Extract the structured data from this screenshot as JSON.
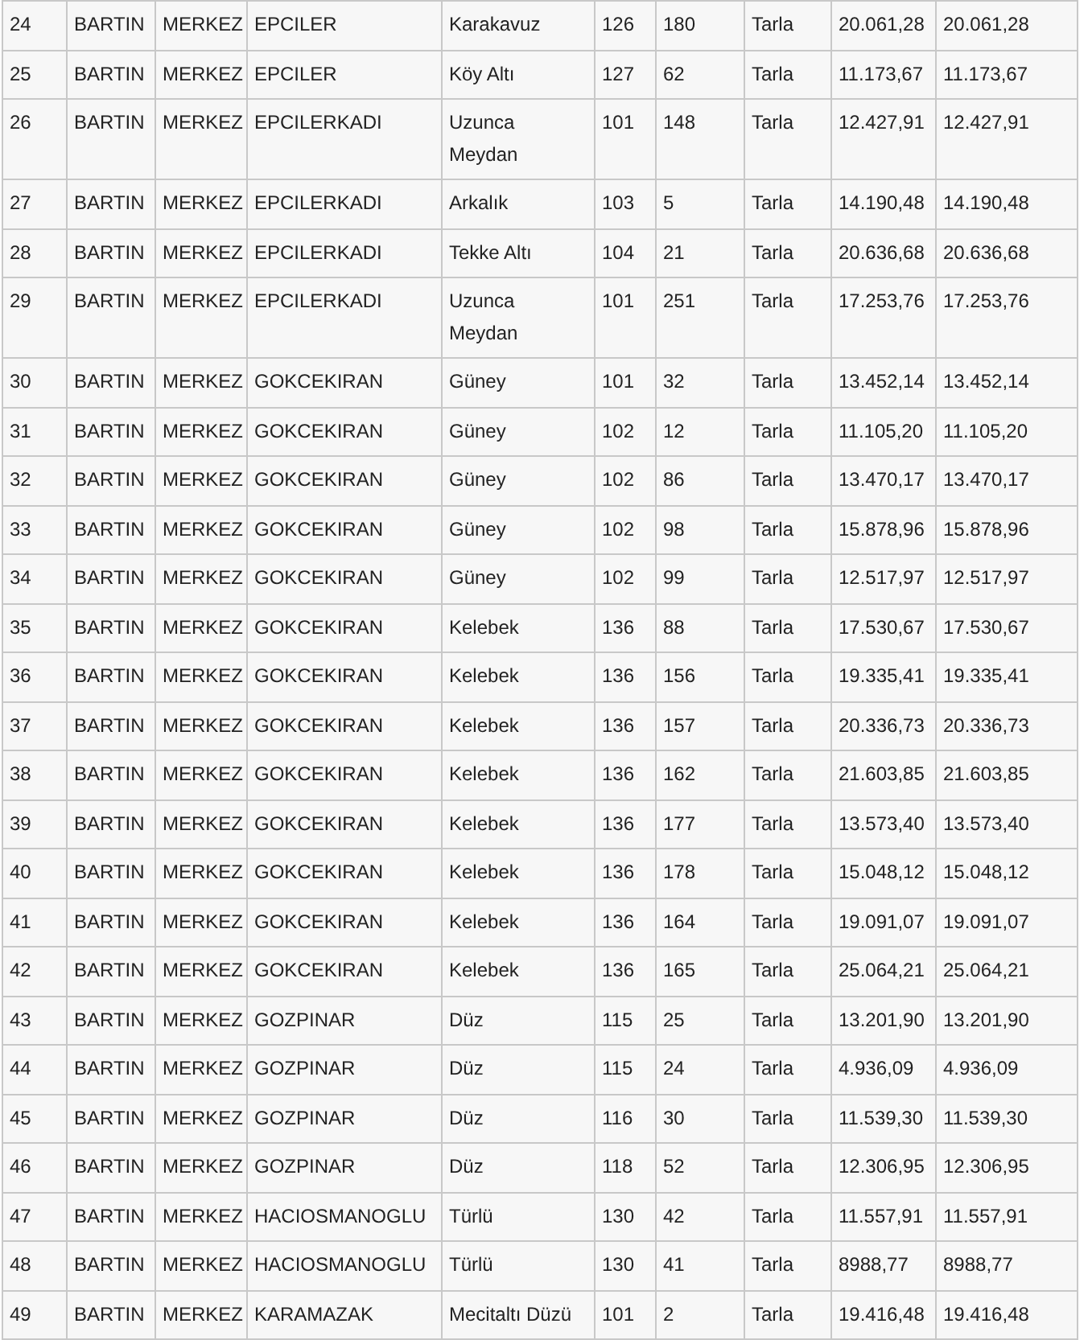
{
  "table": {
    "rows": [
      [
        "24",
        "BARTIN",
        "MERKEZ",
        "EPCILER",
        "Karakavuz",
        "126",
        "180",
        "Tarla",
        "20.061,28",
        "20.061,28"
      ],
      [
        "25",
        "BARTIN",
        "MERKEZ",
        "EPCILER",
        "Köy Altı",
        "127",
        "62",
        "Tarla",
        "11.173,67",
        "11.173,67"
      ],
      [
        "26",
        "BARTIN",
        "MERKEZ",
        "EPCILERKADI",
        "Uzunca\nMeydan",
        "101",
        "148",
        "Tarla",
        "12.427,91",
        "12.427,91"
      ],
      [
        "27",
        "BARTIN",
        "MERKEZ",
        "EPCILERKADI",
        "Arkalık",
        "103",
        "5",
        "Tarla",
        "14.190,48",
        "14.190,48"
      ],
      [
        "28",
        "BARTIN",
        "MERKEZ",
        "EPCILERKADI",
        "Tekke Altı",
        "104",
        "21",
        "Tarla",
        "20.636,68",
        "20.636,68"
      ],
      [
        "29",
        "BARTIN",
        "MERKEZ",
        "EPCILERKADI",
        "Uzunca\nMeydan",
        "101",
        "251",
        "Tarla",
        "17.253,76",
        "17.253,76"
      ],
      [
        "30",
        "BARTIN",
        "MERKEZ",
        "GOKCEKIRAN",
        "Güney",
        "101",
        "32",
        "Tarla",
        "13.452,14",
        "13.452,14"
      ],
      [
        "31",
        "BARTIN",
        "MERKEZ",
        "GOKCEKIRAN",
        "Güney",
        "102",
        "12",
        "Tarla",
        "11.105,20",
        "11.105,20"
      ],
      [
        "32",
        "BARTIN",
        "MERKEZ",
        "GOKCEKIRAN",
        "Güney",
        "102",
        "86",
        "Tarla",
        "13.470,17",
        "13.470,17"
      ],
      [
        "33",
        "BARTIN",
        "MERKEZ",
        "GOKCEKIRAN",
        "Güney",
        "102",
        "98",
        "Tarla",
        "15.878,96",
        "15.878,96"
      ],
      [
        "34",
        "BARTIN",
        "MERKEZ",
        "GOKCEKIRAN",
        "Güney",
        "102",
        "99",
        "Tarla",
        "12.517,97",
        "12.517,97"
      ],
      [
        "35",
        "BARTIN",
        "MERKEZ",
        "GOKCEKIRAN",
        "Kelebek",
        "136",
        "88",
        "Tarla",
        "17.530,67",
        "17.530,67"
      ],
      [
        "36",
        "BARTIN",
        "MERKEZ",
        "GOKCEKIRAN",
        "Kelebek",
        "136",
        "156",
        "Tarla",
        "19.335,41",
        "19.335,41"
      ],
      [
        "37",
        "BARTIN",
        "MERKEZ",
        "GOKCEKIRAN",
        "Kelebek",
        "136",
        "157",
        "Tarla",
        "20.336,73",
        "20.336,73"
      ],
      [
        "38",
        "BARTIN",
        "MERKEZ",
        "GOKCEKIRAN",
        "Kelebek",
        "136",
        "162",
        "Tarla",
        "21.603,85",
        "21.603,85"
      ],
      [
        "39",
        "BARTIN",
        "MERKEZ",
        "GOKCEKIRAN",
        "Kelebek",
        "136",
        "177",
        "Tarla",
        "13.573,40",
        "13.573,40"
      ],
      [
        "40",
        "BARTIN",
        "MERKEZ",
        "GOKCEKIRAN",
        "Kelebek",
        "136",
        "178",
        "Tarla",
        "15.048,12",
        "15.048,12"
      ],
      [
        "41",
        "BARTIN",
        "MERKEZ",
        "GOKCEKIRAN",
        "Kelebek",
        "136",
        "164",
        "Tarla",
        "19.091,07",
        "19.091,07"
      ],
      [
        "42",
        "BARTIN",
        "MERKEZ",
        "GOKCEKIRAN",
        "Kelebek",
        "136",
        "165",
        "Tarla",
        "25.064,21",
        "25.064,21"
      ],
      [
        "43",
        "BARTIN",
        "MERKEZ",
        "GOZPINAR",
        "Düz",
        "115",
        "25",
        "Tarla",
        "13.201,90",
        "13.201,90"
      ],
      [
        "44",
        "BARTIN",
        "MERKEZ",
        "GOZPINAR",
        "Düz",
        "115",
        "24",
        "Tarla",
        "4.936,09",
        "4.936,09"
      ],
      [
        "45",
        "BARTIN",
        "MERKEZ",
        "GOZPINAR",
        "Düz",
        "116",
        "30",
        "Tarla",
        "11.539,30",
        "11.539,30"
      ],
      [
        "46",
        "BARTIN",
        "MERKEZ",
        "GOZPINAR",
        "Düz",
        "118",
        "52",
        "Tarla",
        "12.306,95",
        "12.306,95"
      ],
      [
        "47",
        "BARTIN",
        "MERKEZ",
        "HACIOSMANOGLU",
        "Türlü",
        "130",
        "42",
        "Tarla",
        "11.557,91",
        "11.557,91"
      ],
      [
        "48",
        "BARTIN",
        "MERKEZ",
        "HACIOSMANOGLU",
        "Türlü",
        "130",
        "41",
        "Tarla",
        "8988,77",
        "8988,77"
      ],
      [
        "49",
        "BARTIN",
        "MERKEZ",
        "KARAMAZAK",
        "Mecitaltı Düzü",
        "101",
        "2",
        "Tarla",
        "19.416,48",
        "19.416,48"
      ]
    ]
  }
}
